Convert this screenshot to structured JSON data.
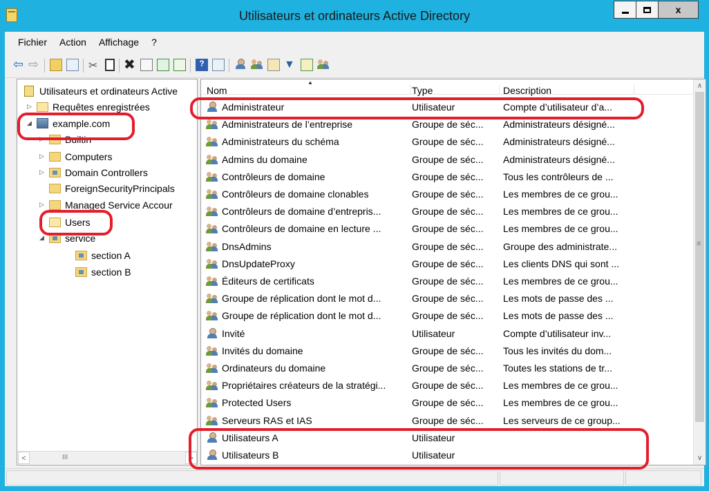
{
  "window": {
    "title": "Utilisateurs et ordinateurs Active Directory",
    "accent_color": "#1fb1e0",
    "close_glyph": "x"
  },
  "menu": [
    {
      "label": "Fichier"
    },
    {
      "label": "Action"
    },
    {
      "label": "Affichage"
    },
    {
      "label": "?"
    }
  ],
  "tree": {
    "root": "Utilisateurs et ordinateurs Active",
    "items": [
      {
        "label": "Requêtes enregistrées",
        "icon": "folder-icon",
        "expander": "▷"
      },
      {
        "label": "example.com",
        "icon": "domain-icon",
        "expander": "◢"
      },
      {
        "label": "Builtin",
        "icon": "folder-icon",
        "expander": "▷"
      },
      {
        "label": "Computers",
        "icon": "folder-icon",
        "expander": "▷"
      },
      {
        "label": "Domain Controllers",
        "icon": "ou-folder-icon",
        "expander": "▷"
      },
      {
        "label": "ForeignSecurityPrincipals",
        "icon": "folder-icon",
        "expander": ""
      },
      {
        "label": "Managed Service Accour",
        "icon": "folder-icon",
        "expander": "▷"
      },
      {
        "label": "Users",
        "icon": "folder-icon",
        "expander": ""
      },
      {
        "label": "service",
        "icon": "ou-folder-icon",
        "expander": "◢"
      },
      {
        "label": "section A",
        "icon": "ou-folder-icon",
        "expander": ""
      },
      {
        "label": "section B",
        "icon": "ou-folder-icon",
        "expander": ""
      }
    ]
  },
  "list": {
    "columns": {
      "name": "Nom",
      "type": "Type",
      "description": "Description"
    },
    "rows": [
      {
        "name": "Administrateur",
        "type": "Utilisateur",
        "description": "Compte d’utilisateur d’a...",
        "icon": "user-icon"
      },
      {
        "name": "Administrateurs de l’entreprise",
        "type": "Groupe de séc...",
        "description": "Administrateurs désigné...",
        "icon": "group-icon"
      },
      {
        "name": "Administrateurs du schéma",
        "type": "Groupe de séc...",
        "description": "Administrateurs désigné...",
        "icon": "group-icon"
      },
      {
        "name": "Admins du domaine",
        "type": "Groupe de séc...",
        "description": "Administrateurs désigné...",
        "icon": "group-icon"
      },
      {
        "name": "Contrôleurs de domaine",
        "type": "Groupe de séc...",
        "description": "Tous les contrôleurs de ...",
        "icon": "group-icon"
      },
      {
        "name": "Contrôleurs de domaine clonables",
        "type": "Groupe de séc...",
        "description": "Les membres de ce grou...",
        "icon": "group-icon"
      },
      {
        "name": "Contrôleurs de domaine d’entrepris...",
        "type": "Groupe de séc...",
        "description": "Les membres de ce grou...",
        "icon": "group-icon"
      },
      {
        "name": "Contrôleurs de domaine en lecture ...",
        "type": "Groupe de séc...",
        "description": "Les membres de ce grou...",
        "icon": "group-icon"
      },
      {
        "name": "DnsAdmins",
        "type": "Groupe de séc...",
        "description": "Groupe des administrate...",
        "icon": "group-icon"
      },
      {
        "name": "DnsUpdateProxy",
        "type": "Groupe de séc...",
        "description": "Les clients DNS qui sont ...",
        "icon": "group-icon"
      },
      {
        "name": "Éditeurs de certificats",
        "type": "Groupe de séc...",
        "description": "Les membres de ce grou...",
        "icon": "group-icon"
      },
      {
        "name": "Groupe de réplication dont le mot d...",
        "type": "Groupe de séc...",
        "description": "Les mots de passe des ...",
        "icon": "group-icon"
      },
      {
        "name": "Groupe de réplication dont le mot d...",
        "type": "Groupe de séc...",
        "description": "Les mots de passe des ...",
        "icon": "group-icon"
      },
      {
        "name": "Invité",
        "type": "Utilisateur",
        "description": "Compte d’utilisateur inv...",
        "icon": "user-icon"
      },
      {
        "name": "Invités du domaine",
        "type": "Groupe de séc...",
        "description": "Tous les invités du dom...",
        "icon": "group-icon"
      },
      {
        "name": "Ordinateurs du domaine",
        "type": "Groupe de séc...",
        "description": "Toutes les stations de tr...",
        "icon": "group-icon"
      },
      {
        "name": "Propriétaires créateurs de la stratégi...",
        "type": "Groupe de séc...",
        "description": "Les membres de ce grou...",
        "icon": "group-icon"
      },
      {
        "name": "Protected Users",
        "type": "Groupe de séc...",
        "description": "Les membres de ce grou...",
        "icon": "group-icon"
      },
      {
        "name": "Serveurs RAS et IAS",
        "type": "Groupe de séc...",
        "description": "Les serveurs de ce group...",
        "icon": "group-icon"
      },
      {
        "name": "Utilisateurs A",
        "type": "Utilisateur",
        "description": "",
        "icon": "user-icon"
      },
      {
        "name": "Utilisateurs B",
        "type": "Utilisateur",
        "description": "",
        "icon": "user-icon"
      }
    ]
  },
  "annotations": {
    "color": "#e41d2b"
  }
}
